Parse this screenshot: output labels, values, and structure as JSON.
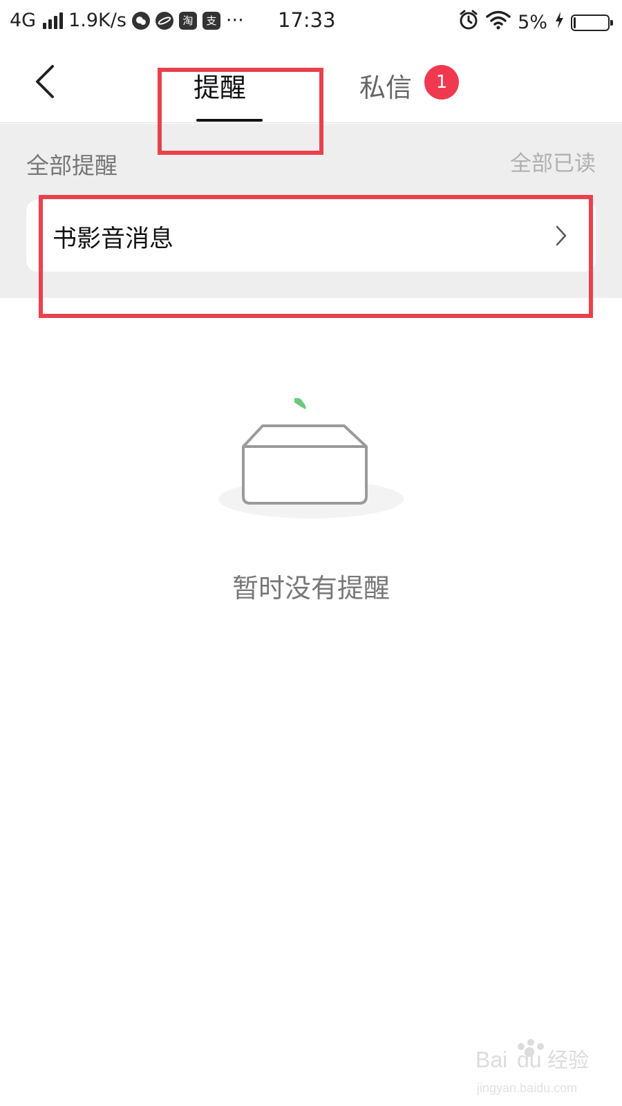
{
  "status_bar": {
    "network": "4G",
    "speed": "1.9K/s",
    "app_icons": [
      "wechat-icon",
      "planet-icon",
      "taobao-icon",
      "alipay-icon"
    ],
    "taobao_glyph": "淘",
    "alipay_glyph": "支",
    "more": "···",
    "time": "17:33",
    "battery": "5%",
    "battery_level": 0.05
  },
  "nav": {
    "tab_reminder": "提醒",
    "tab_messages": "私信",
    "messages_badge": "1"
  },
  "section": {
    "title": "全部提醒",
    "mark_all_read": "全部已读",
    "item_label": "书影音消息"
  },
  "empty_state": {
    "text": "暂时没有提醒"
  },
  "watermark": {
    "brand": "Bai",
    "brand_suffix": "du",
    "product": "经验",
    "url": "jingyan.baidu.com"
  },
  "colors": {
    "badge": "#f0394f",
    "annotation": "#e9414d",
    "leaf": "#6cc77b"
  }
}
